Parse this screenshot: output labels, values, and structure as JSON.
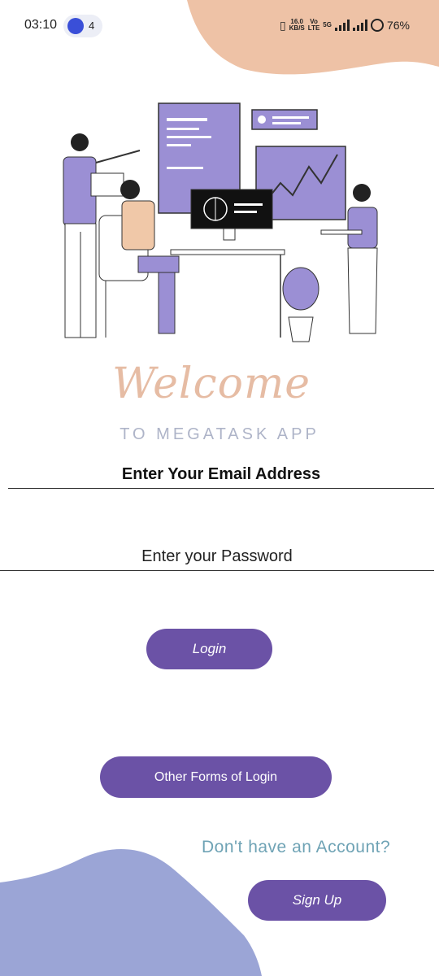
{
  "status_bar": {
    "time": "03:10",
    "notification_count": "4",
    "speed_value": "16.0",
    "speed_unit": "KB/S",
    "volte_top": "Vo",
    "volte_bottom": "LTE",
    "network": "5G",
    "battery": "76%"
  },
  "hero": {
    "welcome": "Welcome",
    "subtitle": "TO MEGATASK APP"
  },
  "form": {
    "email_placeholder": "Enter Your Email Address",
    "password_placeholder": "Enter your Password",
    "login_label": "Login",
    "other_login_label": "Other Forms of Login"
  },
  "signup": {
    "prompt": "Don't have an Account?",
    "button_label": "Sign Up"
  },
  "colors": {
    "accent": "#6b52a6",
    "blob_top": "#eec2a6",
    "blob_bottom": "#9ba5d6",
    "illustration_purple": "#9b8fd4"
  }
}
